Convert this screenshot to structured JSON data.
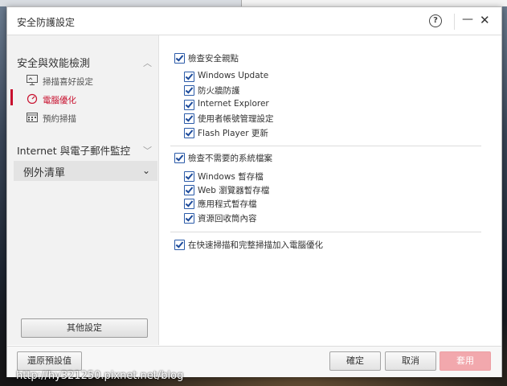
{
  "window": {
    "title": "安全防護設定",
    "help_symbol": "?",
    "minimize_symbol": "—",
    "close_symbol": "✕"
  },
  "sidebar": {
    "section1": {
      "label": "安全與效能檢測",
      "items": [
        {
          "label": "掃描喜好設定",
          "icon": "monitor-icon"
        },
        {
          "label": "電腦優化",
          "icon": "gauge-icon",
          "active": true
        },
        {
          "label": "預約掃描",
          "icon": "calendar-icon"
        }
      ]
    },
    "section2": {
      "label": "Internet 與電子郵件監控"
    },
    "section3": {
      "label": "例外清單"
    },
    "other_settings_label": "其他設定"
  },
  "main": {
    "group1": {
      "label": "檢查安全親點",
      "items": [
        "Windows Update",
        "防火牆防護",
        "Internet Explorer",
        "使用者帳號管理設定",
        "Flash Player 更新"
      ]
    },
    "group2": {
      "label": "檢查不需要的系統檔案",
      "items": [
        "Windows 暫存檔",
        "Web 瀏覽器暫存檔",
        "應用程式暫存檔",
        "資源回收筒內容"
      ]
    },
    "group3": {
      "label": "在快速掃描和完整掃描加入電腦優化"
    }
  },
  "footer": {
    "restore_label": "還原預設值",
    "ok_label": "確定",
    "cancel_label": "取消",
    "apply_label": "套用"
  },
  "watermark": "http://hy321250.pixnet.net/blog",
  "colors": {
    "accent": "#c8102e",
    "checkbox": "#2a5aa8",
    "apply_disabled": "#f2a8ad"
  }
}
